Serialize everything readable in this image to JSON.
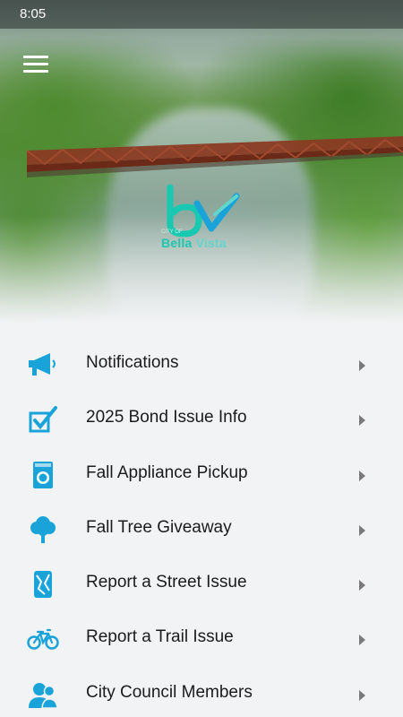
{
  "status_bar": {
    "time": "8:05"
  },
  "header": {
    "menu_icon": "hamburger-menu-icon"
  },
  "logo": {
    "small_text": "CITY OF",
    "name_part1": "Bella",
    "name_part2": "Vista"
  },
  "colors": {
    "accent": "#1aa3d9",
    "logo_teal": "#19c8b1",
    "text": "#1b1b1b",
    "background": "#f2f3f5"
  },
  "menu": {
    "items": [
      {
        "label": "Notifications",
        "icon": "megaphone-icon"
      },
      {
        "label": "2025 Bond Issue Info",
        "icon": "checkbox-icon"
      },
      {
        "label": "Fall Appliance Pickup",
        "icon": "washing-machine-icon"
      },
      {
        "label": "Fall Tree Giveaway",
        "icon": "tree-icon"
      },
      {
        "label": "Report a Street Issue",
        "icon": "map-icon"
      },
      {
        "label": "Report a Trail Issue",
        "icon": "bicycle-icon"
      },
      {
        "label": "City Council Members",
        "icon": "people-icon"
      }
    ]
  }
}
